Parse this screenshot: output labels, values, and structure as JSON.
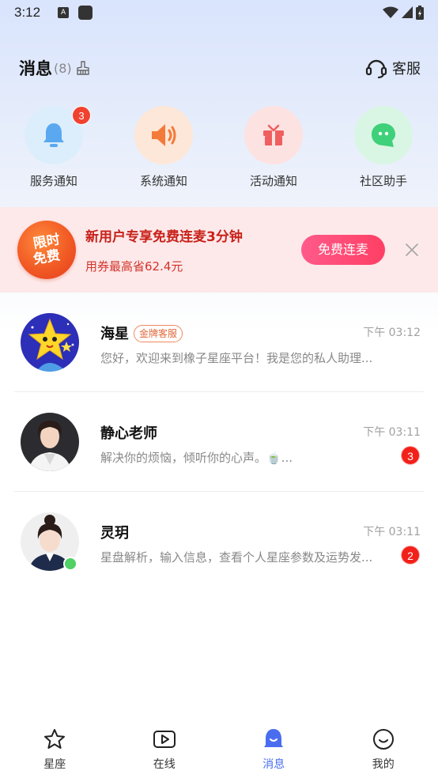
{
  "statusbar": {
    "time": "3:12"
  },
  "header": {
    "title": "消息",
    "count": "(8)",
    "service_label": "客服"
  },
  "shortcuts": [
    {
      "label": "服务通知",
      "icon": "bell-icon",
      "badge": "3",
      "color": "#5aa8f0",
      "bg": "#dceefc"
    },
    {
      "label": "系统通知",
      "icon": "speaker-icon",
      "badge": "",
      "color": "#f47a3a",
      "bg": "#fde7d8"
    },
    {
      "label": "活动通知",
      "icon": "gift-icon",
      "badge": "",
      "color": "#ef5f5f",
      "bg": "#fde2e2"
    },
    {
      "label": "社区助手",
      "icon": "chat-bubble-icon",
      "badge": "",
      "color": "#3fd07a",
      "bg": "#d9f6e4"
    }
  ],
  "promo": {
    "logo_line1": "限时",
    "logo_line2": "免费",
    "title": "新用户专享免费连麦3分钟",
    "subtitle": "用券最高省62.4元",
    "button": "免费连麦"
  },
  "conversations": [
    {
      "name": "海星",
      "tag": "金牌客服",
      "time": "下午 03:12",
      "message": "您好，欢迎来到橡子星座平台！我是您的私人助理...",
      "unread": "",
      "online": false
    },
    {
      "name": "静心老师",
      "tag": "",
      "time": "下午 03:11",
      "message": "解决你的烦恼，倾听你的心声。🍵...",
      "unread": "3",
      "online": false
    },
    {
      "name": "灵玥",
      "tag": "",
      "time": "下午 03:11",
      "message": "星盘解析，输入信息，查看个人星座参数及运势发...",
      "unread": "2",
      "online": true
    }
  ],
  "tabs": [
    {
      "label": "星座",
      "icon": "star-icon",
      "active": false
    },
    {
      "label": "在线",
      "icon": "play-icon",
      "active": false
    },
    {
      "label": "消息",
      "icon": "message-bell-icon",
      "active": true
    },
    {
      "label": "我的",
      "icon": "smiley-icon",
      "active": false
    }
  ],
  "colors": {
    "accent": "#4a6df0",
    "promo_red": "#c8211a",
    "badge_red": "#f2201a"
  }
}
